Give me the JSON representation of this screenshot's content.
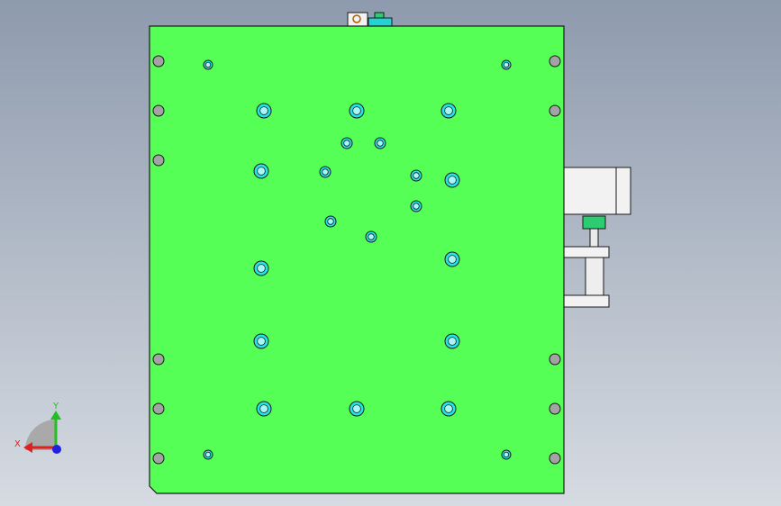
{
  "viewport": {
    "background_top": "#8e9aad",
    "background_bottom": "#d6dbe2"
  },
  "colors": {
    "plate": "#55ff55",
    "edge": "#1a1a1a",
    "hole_outer": "#22e6e6",
    "hole_inner": "#a8f6f6",
    "pin": "#a3a3a3",
    "gray_part": "#f2f2f2",
    "motor_block": "#2ecc71",
    "cyan_block": "#22d3d3",
    "axis_x": "#e02020",
    "axis_y": "#20c020",
    "axis_z": "#2020e0"
  },
  "triad": {
    "x_label": "X",
    "y_label": "Y"
  }
}
